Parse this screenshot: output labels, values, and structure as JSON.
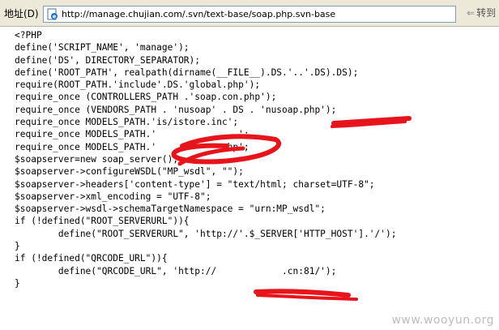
{
  "address_bar": {
    "label": "地址(D)",
    "url": "http://manage.chujian.com/.svn/text-base/soap.php.svn-base",
    "go_label": "转到",
    "page_icon": "ie-page-icon",
    "go_icon": "go-arrow-icon"
  },
  "code_lines": [
    "<?PHP",
    "define('SCRIPT_NAME', 'manage');",
    "define('DS', DIRECTORY_SEPARATOR);",
    "define('ROOT_PATH', realpath(dirname(__FILE__).DS.'..'.DS).DS);",
    "require(ROOT_PATH.'include'.DS.'global.php');",
    "require_once (CONTROLLERS_PATH .'soap.con.php');",
    "require_once (VENDORS_PATH . 'nusoap' . DS . 'nusoap.php');",
    "require_once MODELS_PATH.'is/istore.inc';",
    "require_once MODELS_PATH.'               ';",
    "require_once MODELS_PATH.'           .php';",
    "$soapserver=new soap_server();",
    "$soapserver->configureWSDL(\"MP_wsdl\", \"\");",
    "$soapserver->headers['content-type'] = \"text/html; charset=UTF-8\";",
    "$soapserver->xml_encoding = \"UTF-8\";",
    "$soapserver->wsdl->schemaTargetNamespace = \"urn:MP_wsdl\";",
    "if (!defined(\"ROOT_SERVERURL\")){",
    "        define(\"ROOT_SERVERURL\", 'http://'.$_SERVER['HTTP_HOST'].'/');",
    "}",
    "if (!defined(\"QRCODE_URL\")){",
    "        define(\"QRCODE_URL\", 'http://            .cn:81/');",
    "}"
  ],
  "watermark": "www.wooyun.org",
  "colors": {
    "redaction": "#e8141b",
    "toolbar": "#ece9d8",
    "watermark": "#bdbdbd"
  }
}
